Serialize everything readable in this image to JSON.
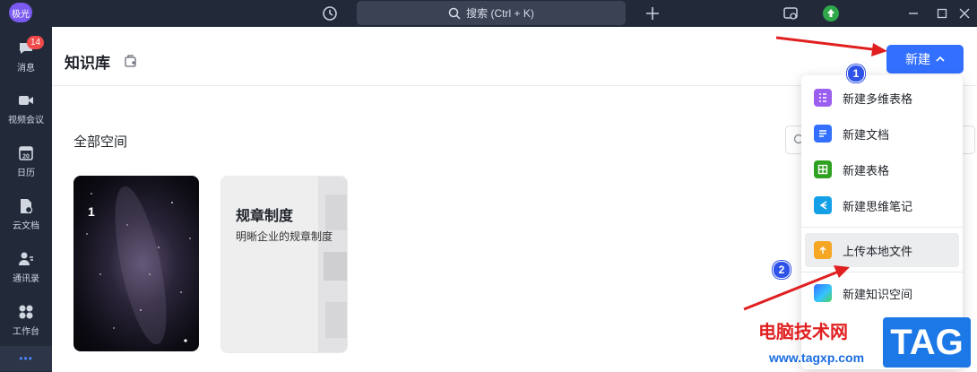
{
  "titlebar": {
    "avatar": "极光",
    "search_label": "搜索 (Ctrl + K)"
  },
  "sidebar": {
    "items": [
      {
        "label": "消息",
        "icon": "chat-bubble-icon",
        "badge": "14"
      },
      {
        "label": "视频会议",
        "icon": "video-camera-icon"
      },
      {
        "label": "日历",
        "icon": "calendar-icon",
        "day": "20"
      },
      {
        "label": "云文档",
        "icon": "cloud-doc-icon"
      },
      {
        "label": "通讯录",
        "icon": "contacts-icon"
      },
      {
        "label": "工作台",
        "icon": "workspace-icon"
      }
    ],
    "more": "•••"
  },
  "header": {
    "title": "知识库",
    "new_button": "新建"
  },
  "main": {
    "section_title": "全部空间",
    "cards": [
      {
        "title": "1",
        "style": "galaxy"
      },
      {
        "title": "规章制度",
        "description": "明晰企业的规章制度"
      }
    ]
  },
  "menu": {
    "items": [
      {
        "label": "新建多维表格",
        "icon": "bitable-icon",
        "color": "#9b5ff0"
      },
      {
        "label": "新建文档",
        "icon": "doc-icon",
        "color": "#3370ff"
      },
      {
        "label": "新建表格",
        "icon": "sheet-icon",
        "color": "#2ea121"
      },
      {
        "label": "新建思维笔记",
        "icon": "mindnote-icon",
        "color": "#14a0e6"
      },
      {
        "label": "上传本地文件",
        "icon": "upload-icon",
        "color": "#f5a623"
      },
      {
        "label": "新建知识空间",
        "icon": "wiki-space-icon",
        "color": "#3370ff"
      }
    ]
  },
  "annotations": {
    "step1": "1",
    "step2": "2"
  },
  "watermark": {
    "site_name": "电脑技术网",
    "url": "www.tagxp.com",
    "tag": "TAG"
  },
  "colors": {
    "accent": "#3370ff",
    "sidebar_bg": "#222a3a",
    "arrow": "#e02020"
  }
}
